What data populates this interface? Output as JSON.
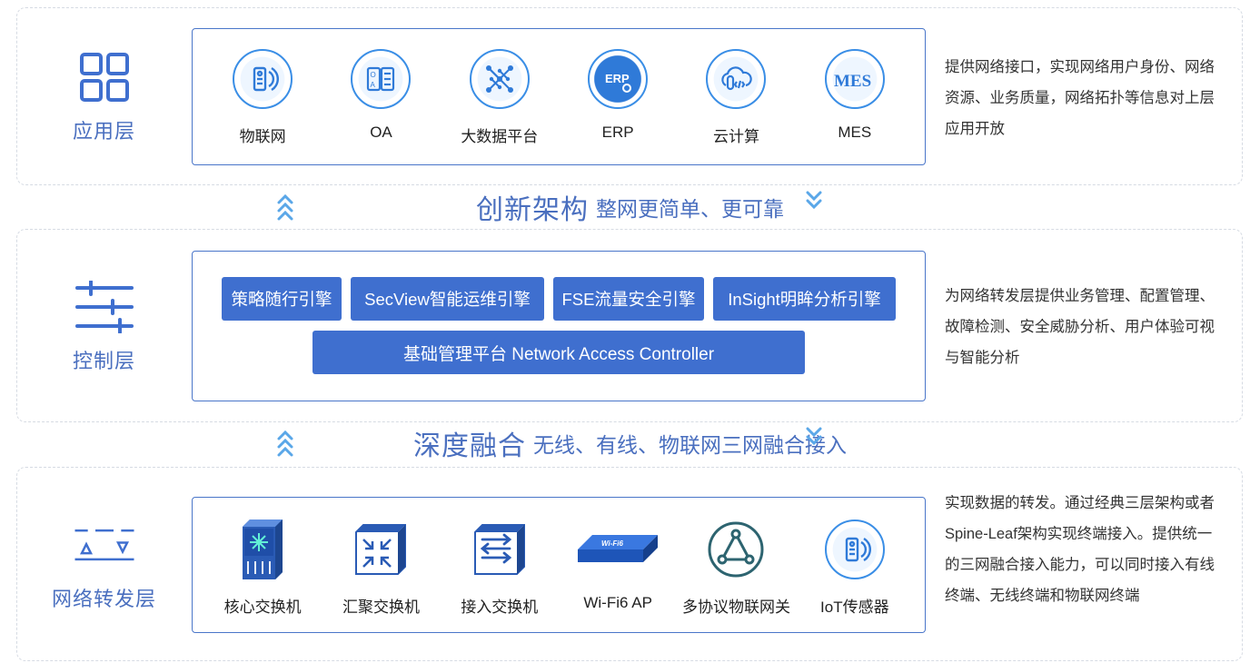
{
  "colors": {
    "accent": "#4a6fbf",
    "button_fill": "#3f6fcf",
    "icon_blue": "#3a8ee6",
    "border": "#4a76c9"
  },
  "banner_1": {
    "main": "创新架构",
    "sub": "整网更简单、更可靠"
  },
  "banner_2": {
    "main": "深度融合",
    "sub": "无线、有线、物联网三网融合接入"
  },
  "application_layer": {
    "title": "应用层",
    "icon": "grid-icon",
    "items": [
      {
        "label": "物联网",
        "icon": "iot-icon"
      },
      {
        "label": "OA",
        "icon": "oa-icon"
      },
      {
        "label": "大数据平台",
        "icon": "big-data-icon"
      },
      {
        "label": "ERP",
        "icon": "erp-icon"
      },
      {
        "label": "云计算",
        "icon": "cloud-icon"
      },
      {
        "label": "MES",
        "icon": "mes-icon"
      }
    ],
    "description": "提供网络接口，实现网络用户身份、网络资源、业务质量，网络拓扑等信息对上层应用开放"
  },
  "control_layer": {
    "title": "控制层",
    "icon": "sliders-icon",
    "engines": [
      "策略随行引擎",
      "SecView智能运维引擎",
      "FSE流量安全引擎",
      "InSight明眸分析引擎"
    ],
    "platform": "基础管理平台 Network Access Controller",
    "description": "为网络转发层提供业务管理、配置管理、故障检测、安全威胁分析、用户体验可视与智能分析"
  },
  "forwarding_layer": {
    "title": "网络转发层",
    "icon": "forwarding-icon",
    "items": [
      {
        "label": "核心交换机",
        "icon": "core-switch-icon"
      },
      {
        "label": "汇聚交换机",
        "icon": "aggregation-switch-icon"
      },
      {
        "label": "接入交换机",
        "icon": "access-switch-icon"
      },
      {
        "label": "Wi-Fi6 AP",
        "icon": "wifi6-ap-icon",
        "badge": "Wi-Fi6"
      },
      {
        "label": "多协议物联网关",
        "icon": "iot-gateway-icon"
      },
      {
        "label": "IoT传感器",
        "icon": "iot-sensor-icon"
      }
    ],
    "description": "实现数据的转发。通过经典三层架构或者Spine-Leaf架构实现终端接入。提供统一的三网融合接入能力，可以同时接入有线终端、无线终端和物联网终端"
  }
}
